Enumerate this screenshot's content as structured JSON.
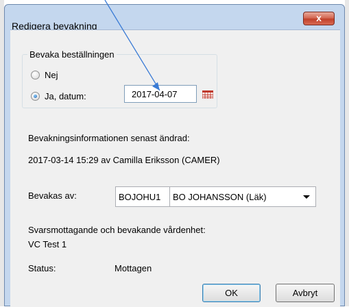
{
  "window": {
    "title": "Redigera bevakning",
    "close_label": "x"
  },
  "group": {
    "label": "Bevaka beställningen",
    "options": [
      {
        "label": "Nej",
        "selected": false
      },
      {
        "label": "Ja, datum:",
        "selected": true
      }
    ],
    "date_value": "2017-04-07"
  },
  "info": {
    "label": "Bevakningsinformationen senast ändrad:",
    "value": "2017-03-14 15:29 av Camilla Eriksson (CAMER)"
  },
  "watched_by": {
    "label": "Bevakas av:",
    "code": "BOJOHU1",
    "name": "BO JOHANSSON (Läk)"
  },
  "unit": {
    "label": "Svarsmottagande och bevakande vårdenhet:",
    "value": "VC Test 1"
  },
  "status": {
    "label": "Status:",
    "value": "Mottagen"
  },
  "buttons": {
    "ok": "OK",
    "cancel": "Avbryt"
  },
  "colors": {
    "titlebar": "#c4d7ee",
    "close": "#c1412b",
    "calendar": "#c0392b",
    "annotation": "#3a7bd5"
  }
}
